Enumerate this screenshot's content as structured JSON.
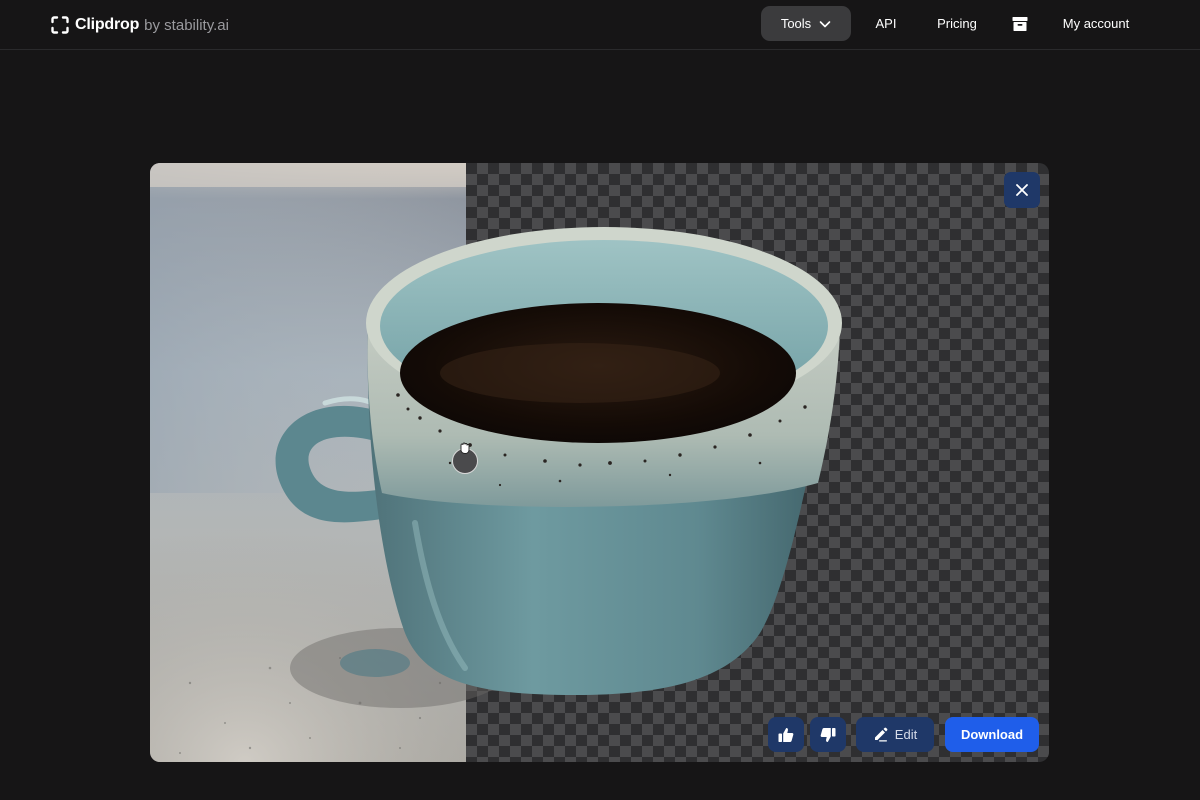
{
  "brand": {
    "name": "Clipdrop",
    "by": "by stability.ai"
  },
  "nav": {
    "tools": "Tools",
    "api": "API",
    "pricing": "Pricing",
    "account": "My account"
  },
  "editor": {
    "edit_label": "Edit",
    "download_label": "Download"
  },
  "icons": {
    "logo": "clipdrop-logo-icon",
    "tools_chevron": "chevron-down-icon",
    "box": "archive-box-icon",
    "close": "close-icon",
    "like": "thumbs-up-icon",
    "dislike": "thumbs-down-icon",
    "edit": "pencil-icon",
    "cursor": "grab-hand-icon"
  },
  "colors": {
    "background": "#161516",
    "accent": "#1f5eea",
    "secondary_button": "#1f3868",
    "nav_active": "#3b3b3d"
  }
}
